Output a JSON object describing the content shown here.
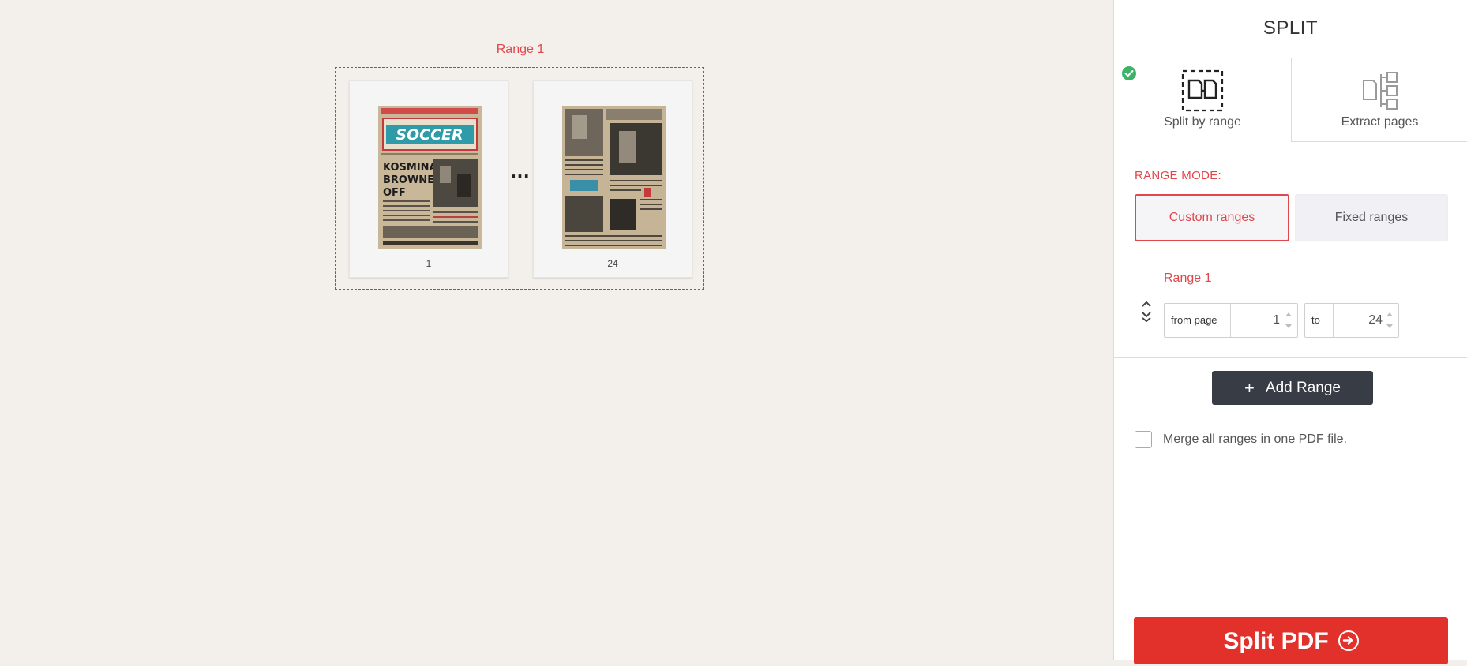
{
  "workspace": {
    "range_caption": "Range 1",
    "pages": [
      {
        "number": "1",
        "headline": "SOCCER",
        "subheadline": "KOSMINA BROWNED OFF"
      },
      {
        "number": "24"
      }
    ],
    "ellipsis": "..."
  },
  "panel": {
    "title": "SPLIT",
    "tabs": [
      {
        "label": "Split by range",
        "icon": "split-by-range-icon",
        "active": true
      },
      {
        "label": "Extract pages",
        "icon": "extract-pages-icon",
        "active": false
      }
    ],
    "range_mode_label": "RANGE MODE:",
    "modes": [
      {
        "label": "Custom ranges",
        "selected": true
      },
      {
        "label": "Fixed ranges",
        "selected": false
      }
    ],
    "range": {
      "title": "Range 1",
      "from_label": "from page",
      "from_value": "1",
      "to_label": "to",
      "to_value": "24"
    },
    "add_range_label": "Add Range",
    "merge_label": "Merge all ranges in one PDF file.",
    "merge_checked": false,
    "split_button_label": "Split PDF"
  },
  "colors": {
    "accent": "#e0474c",
    "primary_button": "#e2302b",
    "dark_button": "#373c45",
    "success": "#3fb26a",
    "workspace_bg": "#f3f0ec"
  }
}
